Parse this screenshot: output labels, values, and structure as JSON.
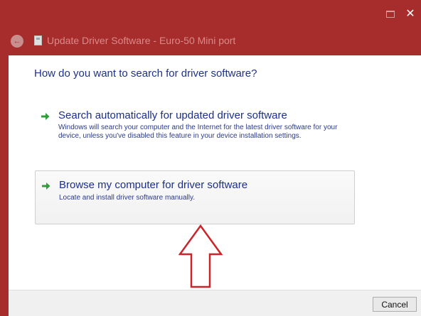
{
  "window": {
    "title": "Update Driver Software - Euro-50 Mini port",
    "restore_icon": "restore-icon",
    "close_glyph": "✕",
    "back_glyph": "←"
  },
  "main": {
    "heading": "How do you want to search for driver software?",
    "options": [
      {
        "title": "Search automatically for updated driver software",
        "description": "Windows will search your computer and the Internet for the latest driver software for your device, unless you've disabled this feature in your device installation settings.",
        "icon": "green-arrow-icon"
      },
      {
        "title": "Browse my computer for driver software",
        "description": "Locate and install driver software manually.",
        "icon": "green-arrow-icon"
      }
    ]
  },
  "footer": {
    "cancel_label": "Cancel"
  },
  "annotation": {
    "icon": "red-outline-up-arrow"
  },
  "colors": {
    "titlebar": "#a72c2c",
    "heading": "#1e3287",
    "option_text": "#1a2f8c",
    "arrow_green": "#2e9e3a",
    "annotation_red": "#c8262a"
  }
}
